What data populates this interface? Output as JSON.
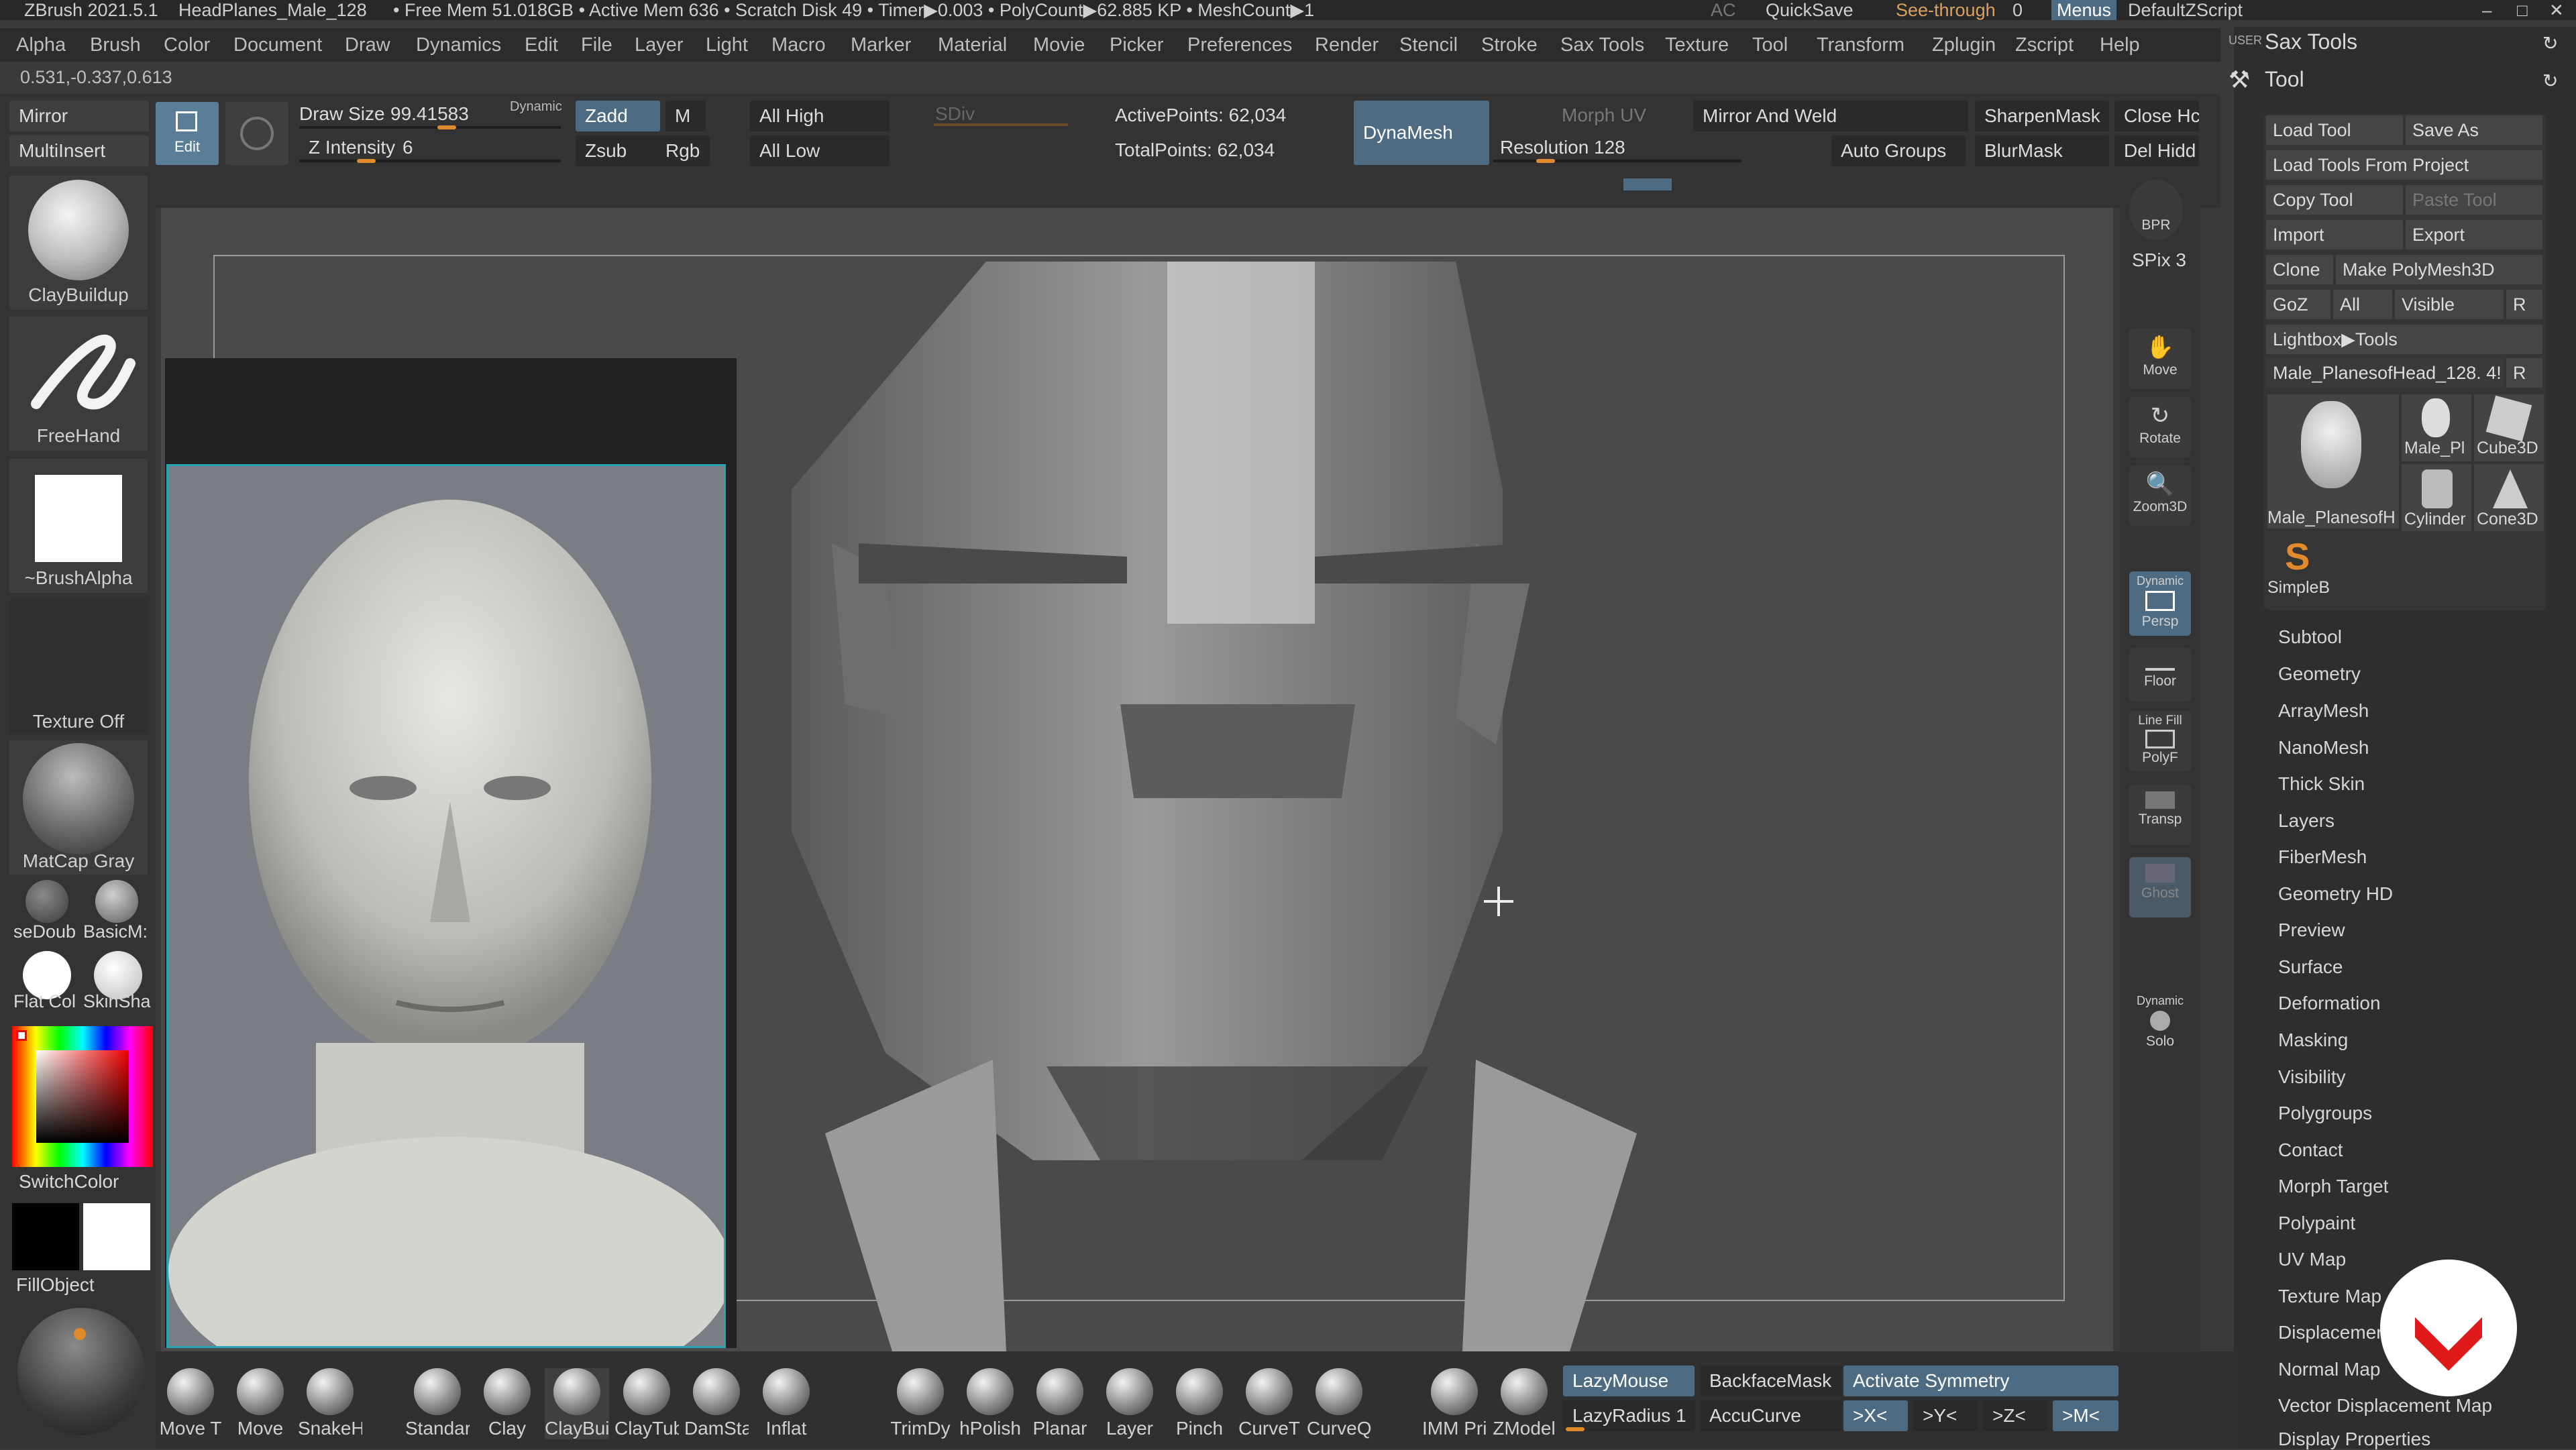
{
  "titlebar": {
    "app": "ZBrush 2021.5.1",
    "file": "HeadPlanes_Male_128",
    "stats": "• Free Mem 51.018GB • Active Mem 636 • Scratch Disk 49 • Timer▶0.003 • PolyCount▶62.885 KP • MeshCount▶1",
    "ac": "AC",
    "quicksave": "QuickSave",
    "seethrough": "See-through",
    "seethrough_val": "0",
    "menus": "Menus",
    "script": "DefaultZScript"
  },
  "menubar": [
    "Alpha",
    "Brush",
    "Color",
    "Document",
    "Draw",
    "Dynamics",
    "Edit",
    "File",
    "Layer",
    "Light",
    "Macro",
    "Marker",
    "Material",
    "Movie",
    "Picker",
    "Preferences",
    "Render",
    "Stencil",
    "Stroke",
    "Sax Tools",
    "Texture",
    "Tool",
    "Transform",
    "Zplugin",
    "Zscript",
    "Help"
  ],
  "coords": "0.531,-0.337,0.613",
  "topbar": {
    "mirror": "Mirror",
    "multiinsert": "MultiInsert",
    "edit": "Edit",
    "draw_size_label": "Draw Size",
    "draw_size_val": "99.41583",
    "dynamic": "Dynamic",
    "z_intensity_label": "Z Intensity",
    "z_intensity_val": "6",
    "zadd": "Zadd",
    "m": "M",
    "zsub": "Zsub",
    "rgb": "Rgb",
    "all_high": "All High",
    "all_low": "All Low",
    "sdiv": "SDiv",
    "active_points": "ActivePoints: 62,034",
    "total_points": "TotalPoints: 62,034",
    "dynamesh": "DynaMesh",
    "morph_uv": "Morph UV",
    "resolution_label": "Resolution",
    "resolution_val": "128",
    "mirror_weld": "Mirror And Weld",
    "auto_groups": "Auto Groups",
    "sharpen_mask": "SharpenMask",
    "blur_mask": "BlurMask",
    "close_holes": "Close Hc",
    "del_hidden": "Del Hidd"
  },
  "leftshelf": {
    "brush": "ClayBuildup",
    "stroke": "FreeHand",
    "alpha": "~BrushAlpha",
    "texture": "Texture Off",
    "material": "MatCap Gray",
    "mat1": "seDoub",
    "mat2": "BasicM:",
    "mat3": "Flat Col",
    "mat4": "SkinSha",
    "switchcolor": "SwitchColor",
    "fillobject": "FillObject"
  },
  "rightshelf": {
    "bpr": "BPR",
    "spix": "SPix 3",
    "move": "Move",
    "rotate": "Rotate",
    "zoom3d": "Zoom3D",
    "dynamic": "Dynamic",
    "persp": "Persp",
    "floor": "Floor",
    "linefill": "Line Fill",
    "polyf": "PolyF",
    "transp": "Transp",
    "ghost": "Ghost",
    "dynamic2": "Dynamic",
    "solo": "Solo"
  },
  "tray": {
    "user": "USER",
    "sax_tools": "Sax Tools",
    "tool": "Tool",
    "load_tool": "Load Tool",
    "save_as": "Save As",
    "load_from_project": "Load Tools From Project",
    "copy_tool": "Copy Tool",
    "paste_tool": "Paste Tool",
    "import": "Import",
    "export": "Export",
    "clone": "Clone",
    "make_polymesh": "Make PolyMesh3D",
    "goz": "GoZ",
    "all": "All",
    "visible": "Visible",
    "r": "R",
    "lightbox_tools": "Lightbox▶Tools",
    "current_tool": "Male_PlanesofHead_128. 4!",
    "tools": [
      "Male_PlanesofH",
      "Male_Pl",
      "Cube3D",
      "Cylinder",
      "Cone3D",
      "SimpleB"
    ],
    "subpalettes": [
      "Subtool",
      "Geometry",
      "ArrayMesh",
      "NanoMesh",
      "Thick Skin",
      "Layers",
      "FiberMesh",
      "Geometry HD",
      "Preview",
      "Surface",
      "Deformation",
      "Masking",
      "Visibility",
      "Polygroups",
      "Contact",
      "Morph Target",
      "Polypaint",
      "UV Map",
      "Texture Map",
      "Displacement Map",
      "Normal Map",
      "Vector Displacement Map",
      "Display Properties"
    ]
  },
  "bottom": {
    "brushes": [
      "Move T",
      "Move",
      "SnakeH",
      "Standar",
      "Clay",
      "ClayBui",
      "ClayTub",
      "DamSta",
      "Inflat",
      "TrimDy",
      "hPolish",
      "Planar",
      "Layer",
      "Pinch",
      "CurveT",
      "CurveQ",
      "IMM Pri",
      "ZModel"
    ],
    "lazymouse": "LazyMouse",
    "lazyradius": "LazyRadius 1",
    "backfacemask": "BackfaceMask",
    "accucurve": "AccuCurve",
    "activate_symmetry": "Activate Symmetry",
    "x": ">X<",
    "y": ">Y<",
    "z": ">Z<",
    "m": ">M<"
  }
}
